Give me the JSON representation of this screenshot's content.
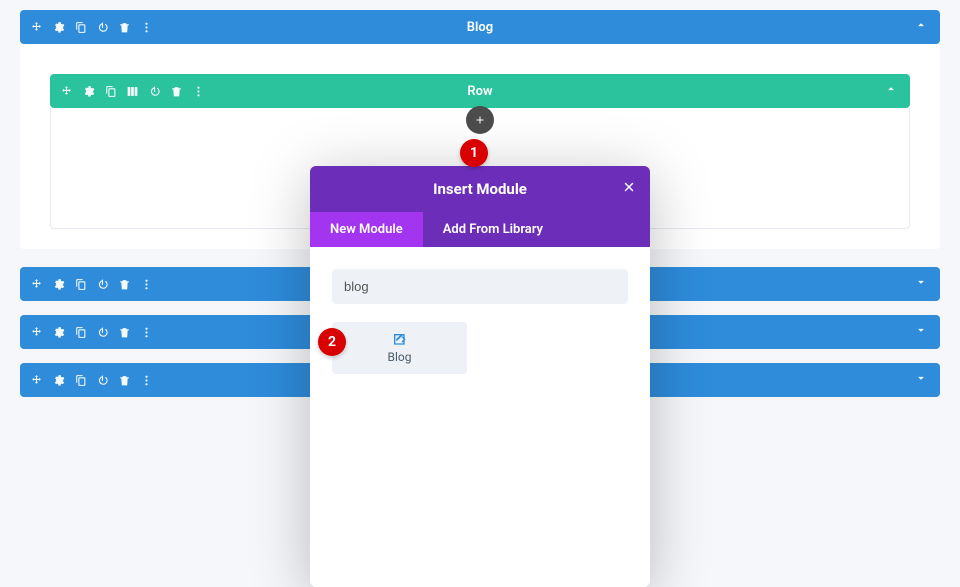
{
  "sections": {
    "blog": {
      "label": "Blog"
    },
    "row": {
      "label": "Row"
    }
  },
  "collapsed": {
    "label": ""
  },
  "modal": {
    "title": "Insert Module",
    "tabs": {
      "new": "New Module",
      "library": "Add From Library"
    },
    "searchValue": "blog"
  },
  "modules": {
    "blog": {
      "label": "Blog"
    }
  },
  "callouts": {
    "one": "1",
    "two": "2"
  }
}
